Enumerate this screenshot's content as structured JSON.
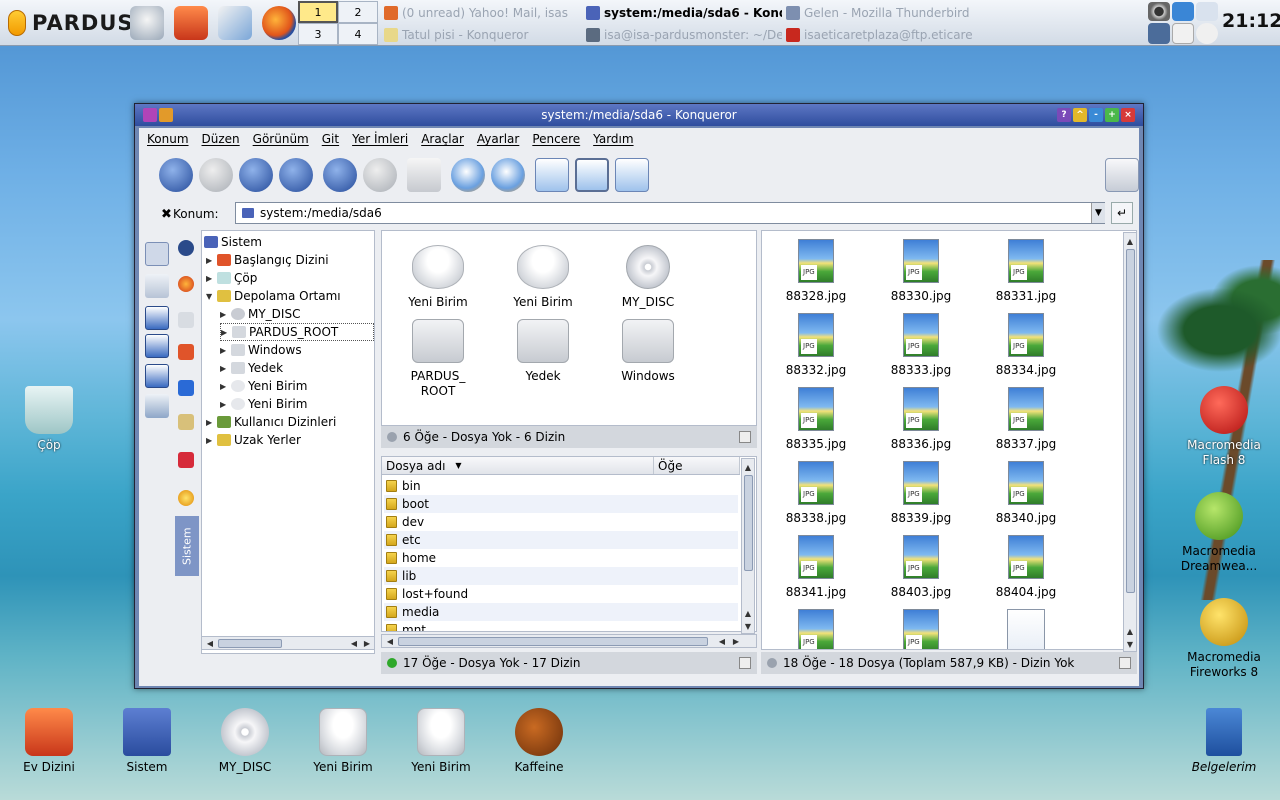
{
  "panel": {
    "logo": "PARDUS",
    "pager": [
      "1",
      "2",
      "3",
      "4"
    ],
    "tasks": [
      {
        "label": "(0 unread) Yahoo! Mail, isas",
        "active": false
      },
      {
        "label": "system:/media/sda6 - Konqu",
        "active": true
      },
      {
        "label": "Gelen - Mozilla Thunderbird",
        "active": false
      },
      {
        "label": "Tatul pisi - Konqueror",
        "active": false
      },
      {
        "label": "isa@isa-pardusmonster: ~/De",
        "active": false
      },
      {
        "label": "isaeticaretplaza@ftp.eticare",
        "active": false
      }
    ],
    "clock": "21:12"
  },
  "desktop": {
    "icons": [
      {
        "label": "Çöp"
      },
      {
        "label": "Ev Dizini"
      },
      {
        "label": "Sistem"
      },
      {
        "label": "MY_DISC"
      },
      {
        "label": "Yeni Birim"
      },
      {
        "label": "Yeni Birim"
      },
      {
        "label": "Kaffeine"
      },
      {
        "label": "Macromedia Flash 8"
      },
      {
        "label": "Macromedia Dreamwea..."
      },
      {
        "label": "Macromedia Fireworks 8"
      },
      {
        "label": "Belgelerim"
      }
    ]
  },
  "window": {
    "title": "system:/media/sda6 - Konqueror",
    "menu": [
      "Konum",
      "Düzen",
      "Görünüm",
      "Git",
      "Yer İmleri",
      "Araçlar",
      "Ayarlar",
      "Pencere",
      "Yardım"
    ],
    "location_label": "Konum:",
    "location_value": "system:/media/sda6",
    "sidebar_tab": "Sistem",
    "tree": [
      {
        "label": "Sistem",
        "level": 0,
        "arrow": ""
      },
      {
        "label": "Başlangıç Dizini",
        "level": 1,
        "arrow": "▶"
      },
      {
        "label": "Çöp",
        "level": 1,
        "arrow": "▶"
      },
      {
        "label": "Depolama Ortamı",
        "level": 1,
        "arrow": "▼"
      },
      {
        "label": "MY_DISC",
        "level": 2,
        "arrow": "▶"
      },
      {
        "label": "PARDUS_ROOT",
        "level": 2,
        "arrow": "▶"
      },
      {
        "label": "Windows",
        "level": 2,
        "arrow": "▶"
      },
      {
        "label": "Yedek",
        "level": 2,
        "arrow": "▶"
      },
      {
        "label": "Yeni Birim",
        "level": 2,
        "arrow": "▶"
      },
      {
        "label": "Yeni Birim",
        "level": 2,
        "arrow": "▶"
      },
      {
        "label": "Kullanıcı Dizinleri",
        "level": 1,
        "arrow": "▶"
      },
      {
        "label": "Uzak Yerler",
        "level": 1,
        "arrow": "▶"
      }
    ],
    "media": [
      {
        "label": "Yeni Birim",
        "kind": "usb"
      },
      {
        "label": "Yeni Birim",
        "kind": "usb"
      },
      {
        "label": "MY_DISC",
        "kind": "dvd"
      },
      {
        "label": "PARDUS_\nROOT",
        "kind": "hdd"
      },
      {
        "label": "Yedek",
        "kind": "hdd"
      },
      {
        "label": "Windows",
        "kind": "hdd"
      }
    ],
    "media_status": "6 Öğe - Dosya Yok - 6 Dizin",
    "list_headers": {
      "name": "Dosya adı",
      "items": "Öğe"
    },
    "dirs": [
      "bin",
      "boot",
      "dev",
      "etc",
      "home",
      "lib",
      "lost+found",
      "media",
      "mnt"
    ],
    "dirs_status": "17 Öğe - Dosya Yok - 17 Dizin",
    "images": [
      "88328.jpg",
      "88330.jpg",
      "88331.jpg",
      "88332.jpg",
      "88333.jpg",
      "88334.jpg",
      "88335.jpg",
      "88336.jpg",
      "88337.jpg",
      "88338.jpg",
      "88339.jpg",
      "88340.jpg",
      "88341.jpg",
      "88403.jpg",
      "88404.jpg",
      "",
      "",
      ""
    ],
    "images_status": "18 Öğe - 18 Dosya (Toplam 587,9 KB) - Dizin Yok"
  }
}
